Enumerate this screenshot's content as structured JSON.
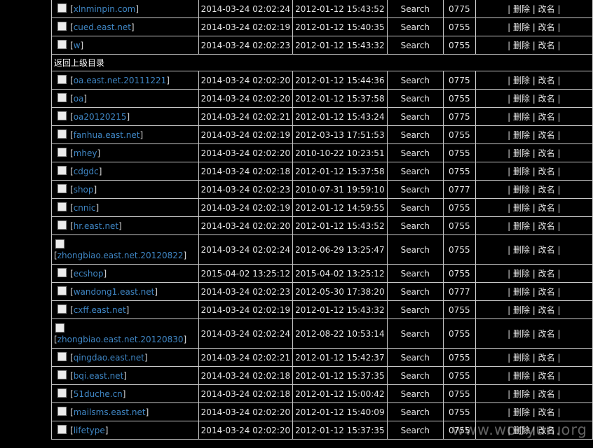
{
  "listing": {
    "section_label": "返回上级目录",
    "action_sep": "|",
    "delete_label": "删除",
    "rename_label": "改名",
    "top_rows": [
      {
        "name": "xlnminpin.com",
        "created": "2014-03-24 02:02:24",
        "modified": "2012-01-12 15:43:52",
        "type": "Search",
        "perm": "0775"
      },
      {
        "name": "cued.east.net",
        "created": "2014-03-24 02:02:19",
        "modified": "2012-01-12 15:40:35",
        "type": "Search",
        "perm": "0755"
      },
      {
        "name": "w",
        "created": "2014-03-24 02:02:23",
        "modified": "2012-01-12 15:43:32",
        "type": "Search",
        "perm": "0755"
      }
    ],
    "rows": [
      {
        "name": "oa.east.net.20111221",
        "created": "2014-03-24 02:02:20",
        "modified": "2012-01-12 15:44:36",
        "type": "Search",
        "perm": "0775"
      },
      {
        "name": "oa",
        "created": "2014-03-24 02:02:20",
        "modified": "2012-01-12 15:37:58",
        "type": "Search",
        "perm": "0755"
      },
      {
        "name": "oa20120215",
        "created": "2014-03-24 02:02:21",
        "modified": "2012-01-12 15:43:24",
        "type": "Search",
        "perm": "0775"
      },
      {
        "name": "fanhua.east.net",
        "created": "2014-03-24 02:02:19",
        "modified": "2012-03-13 17:51:53",
        "type": "Search",
        "perm": "0755"
      },
      {
        "name": "mhey",
        "created": "2014-03-24 02:02:20",
        "modified": "2010-10-22 10:23:51",
        "type": "Search",
        "perm": "0755"
      },
      {
        "name": "cdgdc",
        "created": "2014-03-24 02:02:18",
        "modified": "2012-01-12 15:37:58",
        "type": "Search",
        "perm": "0755"
      },
      {
        "name": "shop",
        "created": "2014-03-24 02:02:23",
        "modified": "2010-07-31 19:59:10",
        "type": "Search",
        "perm": "0777"
      },
      {
        "name": "cnnic",
        "created": "2014-03-24 02:02:19",
        "modified": "2012-01-12 14:59:55",
        "type": "Search",
        "perm": "0755"
      },
      {
        "name": "hr.east.net",
        "created": "2014-03-24 02:02:20",
        "modified": "2012-01-12 15:43:52",
        "type": "Search",
        "perm": "0755"
      },
      {
        "name": "zhongbiao.east.net.20120822",
        "created": "2014-03-24 02:02:24",
        "modified": "2012-06-29 13:25:47",
        "type": "Search",
        "perm": "0755",
        "tall": true
      },
      {
        "name": "ecshop",
        "created": "2015-04-02 13:25:12",
        "modified": "2015-04-02 13:25:12",
        "type": "Search",
        "perm": "0755"
      },
      {
        "name": "wandong1.east.net",
        "created": "2014-03-24 02:02:23",
        "modified": "2012-05-30 17:38:20",
        "type": "Search",
        "perm": "0777"
      },
      {
        "name": "cxff.east.net",
        "created": "2014-03-24 02:02:19",
        "modified": "2012-01-12 15:43:32",
        "type": "Search",
        "perm": "0755"
      },
      {
        "name": "zhongbiao.east.net.20120830",
        "created": "2014-03-24 02:02:24",
        "modified": "2012-08-22 10:53:14",
        "type": "Search",
        "perm": "0755",
        "tall": true
      },
      {
        "name": "qingdao.east.net",
        "created": "2014-03-24 02:02:21",
        "modified": "2012-01-12 15:42:37",
        "type": "Search",
        "perm": "0755"
      },
      {
        "name": "bqi.east.net",
        "created": "2014-03-24 02:02:18",
        "modified": "2012-01-12 15:37:35",
        "type": "Search",
        "perm": "0755"
      },
      {
        "name": "51duche.cn",
        "created": "2014-03-24 02:02:18",
        "modified": "2012-01-12 15:00:42",
        "type": "Search",
        "perm": "0755"
      },
      {
        "name": "mailsms.east.net",
        "created": "2014-03-24 02:02:20",
        "modified": "2012-01-12 15:40:09",
        "type": "Search",
        "perm": "0755"
      },
      {
        "name": "lifetype",
        "created": "2014-03-24 02:02:20",
        "modified": "2012-01-12 15:37:35",
        "type": "Search",
        "perm": "0755"
      }
    ]
  },
  "watermark": "www.wooyun.org"
}
